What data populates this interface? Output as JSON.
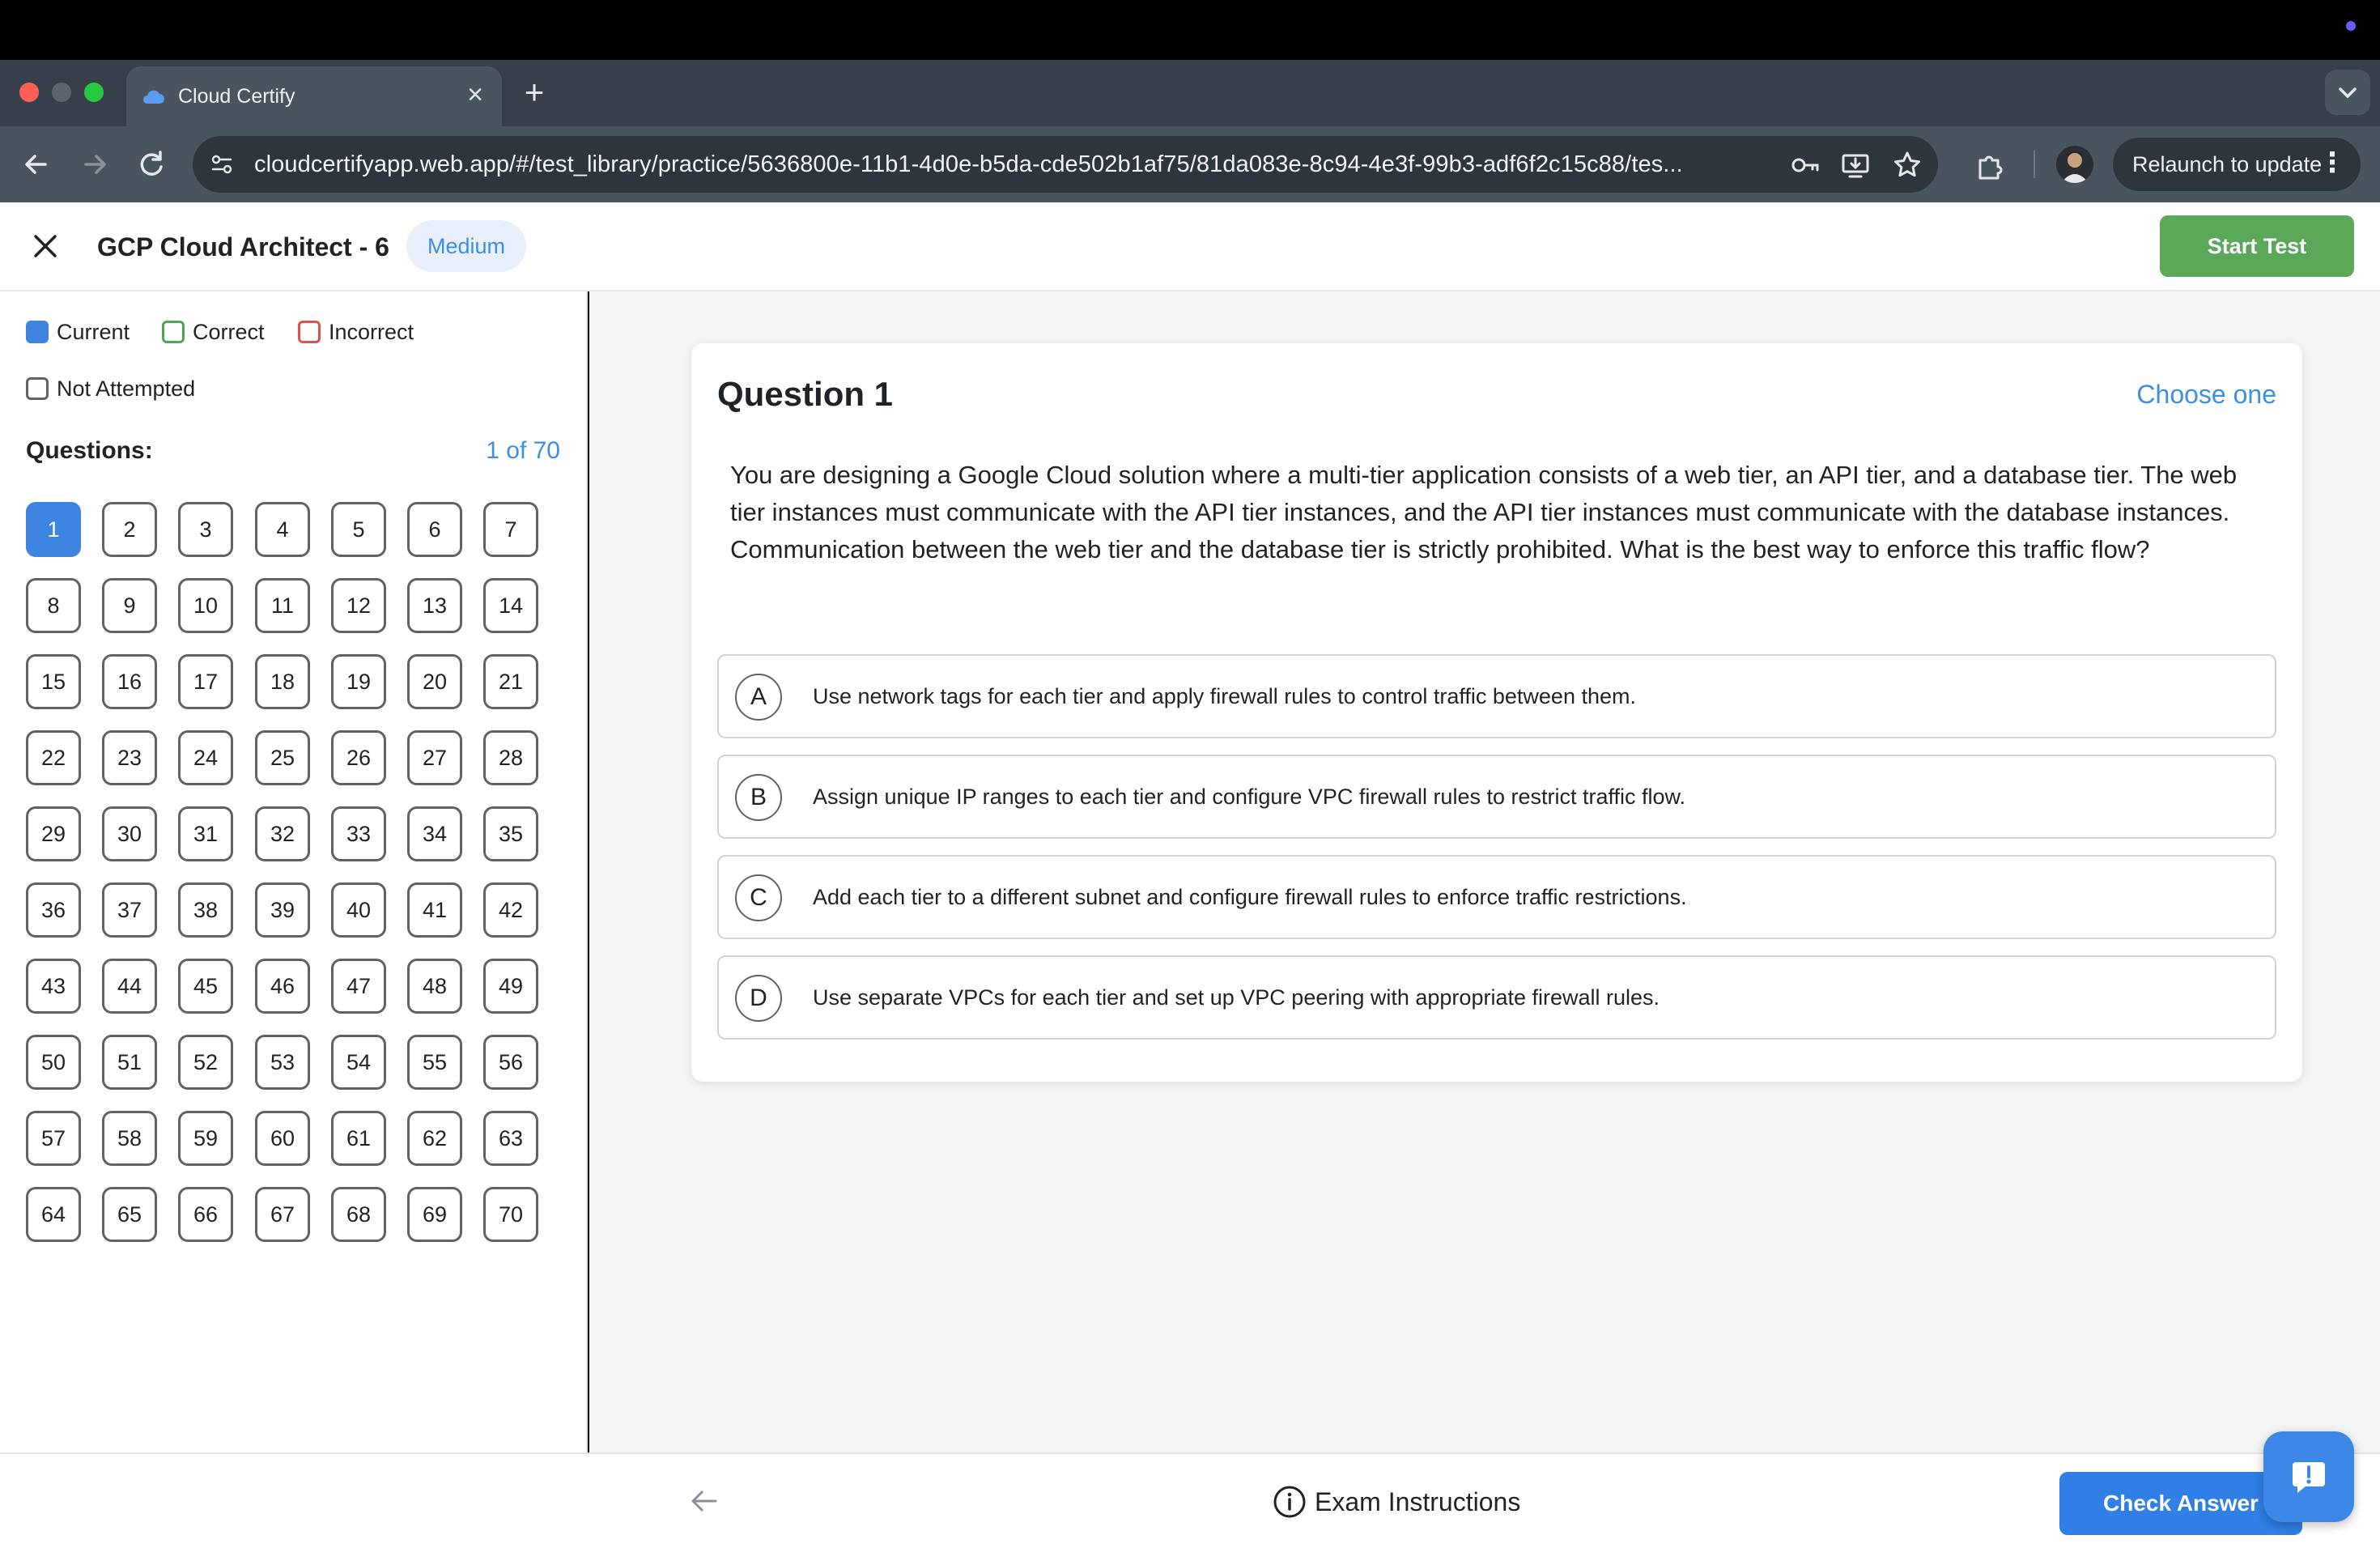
{
  "browser": {
    "tab_title": "Cloud Certify",
    "url": "cloudcertifyapp.web.app/#/test_library/practice/5636800e-11b1-4d0e-b5da-cde502b1af75/81da083e-8c94-4e3f-99b3-adf6f2c15c88/tes...",
    "relaunch_label": "Relaunch to update",
    "colors": {
      "chrome": "#4a545f",
      "omnibox": "#2e353d"
    }
  },
  "header": {
    "title": "GCP Cloud Architect - 6",
    "difficulty": "Medium",
    "start_label": "Start Test"
  },
  "sidebar": {
    "legend": {
      "current": "Current",
      "correct": "Correct",
      "incorrect": "Incorrect",
      "not_attempted": "Not Attempted"
    },
    "questions_label": "Questions:",
    "count": "1 of 70",
    "current_question": 1,
    "total_questions": 70
  },
  "question": {
    "title": "Question 1",
    "mode": "Choose one",
    "text": "You are designing a Google Cloud solution where a multi-tier application consists of a web tier, an API tier, and a database tier. The web tier instances must communicate with the API tier instances, and the API tier instances must communicate with the database instances. Communication between the web tier and the database tier is strictly prohibited. What is the best way to enforce this traffic flow?",
    "options": [
      {
        "letter": "A",
        "text": "Use network tags for each tier and apply firewall rules to control traffic between them."
      },
      {
        "letter": "B",
        "text": "Assign unique IP ranges to each tier and configure VPC firewall rules to restrict traffic flow."
      },
      {
        "letter": "C",
        "text": "Add each tier to a different subnet and configure firewall rules to enforce traffic restrictions."
      },
      {
        "letter": "D",
        "text": "Use separate VPCs for each tier and set up VPC peering with appropriate firewall rules."
      }
    ]
  },
  "footer": {
    "instructions_label": "Exam Instructions",
    "check_label": "Check Answer"
  },
  "theme": {
    "accent_blue": "#3d85e0",
    "start_green": "#5ba85b",
    "incorrect_red": "#e0504c"
  },
  "icons": [
    "close-icon",
    "back-arrow-icon",
    "forward-arrow-icon",
    "reload-icon",
    "site-settings-icon",
    "password-key-icon",
    "install-app-icon",
    "bookmark-star-icon",
    "extensions-icon",
    "info-icon",
    "chat-feedback-icon"
  ]
}
